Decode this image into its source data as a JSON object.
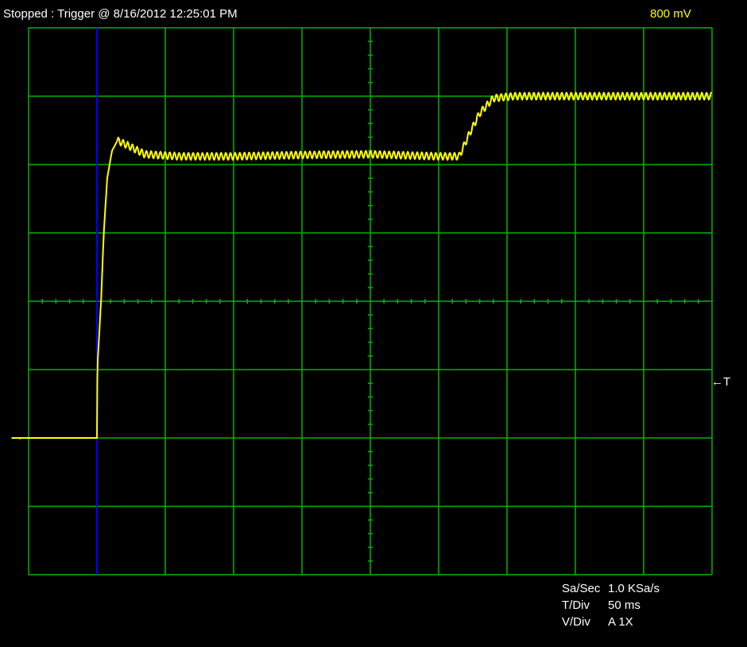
{
  "status": "Stopped : Trigger @ 8/16/2012 12:25:01 PM",
  "channel_scale": "800 mV",
  "trigger_marker": "←T",
  "ground_marker": "→",
  "info": [
    {
      "label": "Sa/Sec",
      "value": "1.0 KSa/s"
    },
    {
      "label": "T/Div",
      "value": "50 ms"
    },
    {
      "label": "V/Div",
      "value": "A 1X"
    }
  ],
  "colors": {
    "grid": "#00b400",
    "trace": "#ffff00",
    "trigger_cursor": "#0000ff",
    "background": "#000000",
    "text": "#ffffff"
  },
  "chart_data": {
    "type": "line",
    "grid": true,
    "divisions": {
      "x": 10,
      "y": 8
    },
    "x_unit": "div",
    "y_unit": "div",
    "xlim": [
      0,
      10
    ],
    "ylim": [
      0,
      8
    ],
    "trigger_x": 1.0,
    "ground_level": 2.0,
    "ripple_amplitude": 0.05,
    "series": [
      {
        "x": [
          -0.25,
          1.0,
          1.0,
          1.01,
          1.06,
          1.1,
          1.15,
          1.22,
          1.3,
          1.45,
          1.7,
          2.2,
          3.0,
          4.0,
          5.0,
          6.0,
          6.3,
          6.45,
          6.6,
          6.8,
          7.1,
          8.0,
          9.0,
          10.0
        ],
        "y": [
          2.0,
          2.0,
          2.5,
          3.1,
          4.0,
          5.0,
          5.8,
          6.2,
          6.35,
          6.28,
          6.15,
          6.12,
          6.12,
          6.14,
          6.15,
          6.12,
          6.12,
          6.45,
          6.75,
          6.97,
          7.0,
          7.0,
          7.0,
          7.0
        ]
      }
    ]
  }
}
